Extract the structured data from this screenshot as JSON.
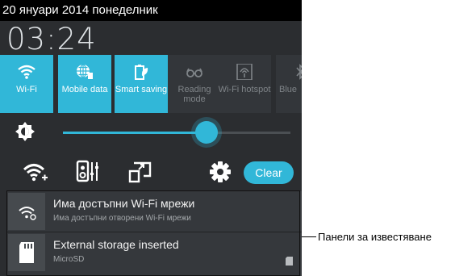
{
  "status_bar": {
    "date": "20 януари 2014 понеделник"
  },
  "clock": {
    "time": "03:24"
  },
  "quick_settings": [
    {
      "label": "Wi-Fi",
      "icon": "wifi-icon",
      "state": "on"
    },
    {
      "label": "Mobile data",
      "icon": "globe-icon",
      "state": "on"
    },
    {
      "label": "Smart saving",
      "icon": "battery-leaf-icon",
      "state": "on"
    },
    {
      "label": "Reading mode",
      "icon": "glasses-icon",
      "state": "off"
    },
    {
      "label": "Wi-Fi hotspot",
      "icon": "hotspot-icon",
      "state": "off"
    },
    {
      "label": "Blue",
      "icon": "bluetooth-icon",
      "state": "off"
    }
  ],
  "brightness": {
    "level": 0.63,
    "icon": "brightness-icon"
  },
  "actions": {
    "icons": [
      "wifi-settings-icon",
      "audio-mixer-icon",
      "screen-cast-icon",
      "gear-icon"
    ],
    "clear_label": "Clear"
  },
  "notifications": [
    {
      "title": "Има достъпни Wi-Fi мрежи",
      "subtitle": "Има достъпни отворени Wi-Fi мрежи",
      "icon": "wifi-notification-icon"
    },
    {
      "title": "External storage inserted",
      "subtitle": "MicroSD",
      "icon": "sd-card-icon"
    }
  ],
  "callout": {
    "text": "Панели за известяване"
  },
  "colors": {
    "accent": "#31b7d8",
    "panel": "#2b2d30",
    "status_bar": "#000000"
  }
}
